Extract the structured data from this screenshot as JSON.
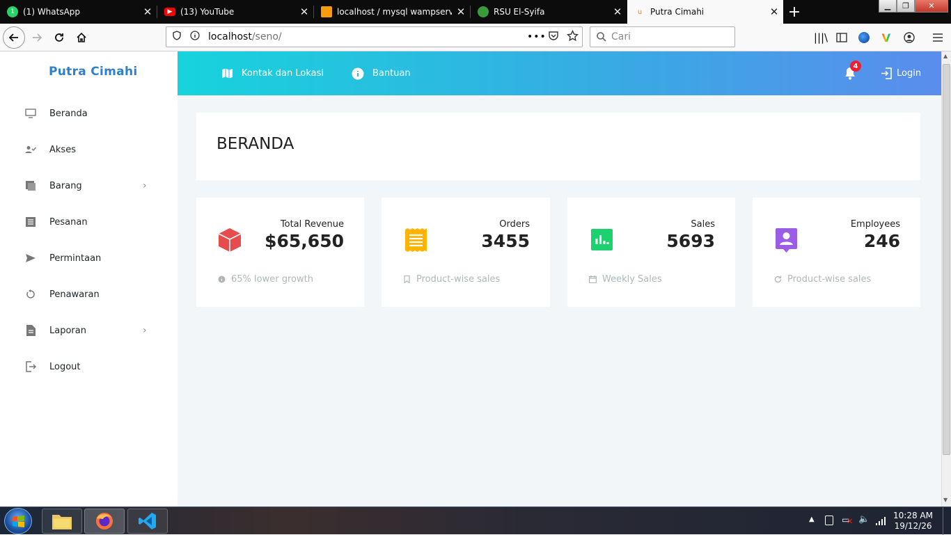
{
  "browser": {
    "tabs": [
      {
        "title": "(1) WhatsApp",
        "icon": "whatsapp-icon",
        "color": "#25d366",
        "badge": "1"
      },
      {
        "title": "(13) YouTube",
        "icon": "youtube-icon",
        "color": "#ff0000"
      },
      {
        "title": "localhost / mysql wampserver |",
        "icon": "phpmyadmin-icon",
        "color": "#f89c0e"
      },
      {
        "title": "RSU El-Syifa",
        "icon": "rsu-icon",
        "color": "#3a9b3a"
      },
      {
        "title": "Putra Cimahi",
        "icon": "page-favicon",
        "color": "#f08030"
      }
    ],
    "url_host": "localhost",
    "url_path": "/seno/",
    "search_placeholder": "Cari"
  },
  "sidebar": {
    "brand_a": "Putra",
    "brand_b": "Cimahi",
    "items": [
      {
        "label": "Beranda",
        "icon": "monitor-icon"
      },
      {
        "label": "Akses",
        "icon": "user-check-icon"
      },
      {
        "label": "Barang",
        "icon": "box-icon",
        "has_submenu": true
      },
      {
        "label": "Pesanan",
        "icon": "list-icon"
      },
      {
        "label": "Permintaan",
        "icon": "send-icon"
      },
      {
        "label": "Penawaran",
        "icon": "refresh-icon"
      },
      {
        "label": "Laporan",
        "icon": "file-icon",
        "has_submenu": true
      },
      {
        "label": "Logout",
        "icon": "logout-icon"
      }
    ]
  },
  "topnav": {
    "contact": "Kontak dan Lokasi",
    "help": "Bantuan",
    "notifications": "4",
    "login": "Login"
  },
  "page": {
    "title": "BERANDA"
  },
  "stats": [
    {
      "title": "Total Revenue",
      "value": "$65,650",
      "foot": "65% lower growth",
      "color": "#e74c4c",
      "icon": "cube-icon",
      "foot_icon": "info-icon"
    },
    {
      "title": "Orders",
      "value": "3455",
      "foot": "Product-wise sales",
      "color": "#ffb300",
      "icon": "receipt-icon",
      "foot_icon": "bookmark-icon"
    },
    {
      "title": "Sales",
      "value": "5693",
      "foot": "Weekly Sales",
      "color": "#1ed16f",
      "icon": "bar-chart-icon",
      "foot_icon": "calendar-icon"
    },
    {
      "title": "Employees",
      "value": "246",
      "foot": "Product-wise sales",
      "color": "#9b5de5",
      "icon": "user-card-icon",
      "foot_icon": "refresh-icon"
    }
  ],
  "taskbar": {
    "time": "10:28 AM",
    "date": "19/12/26"
  }
}
